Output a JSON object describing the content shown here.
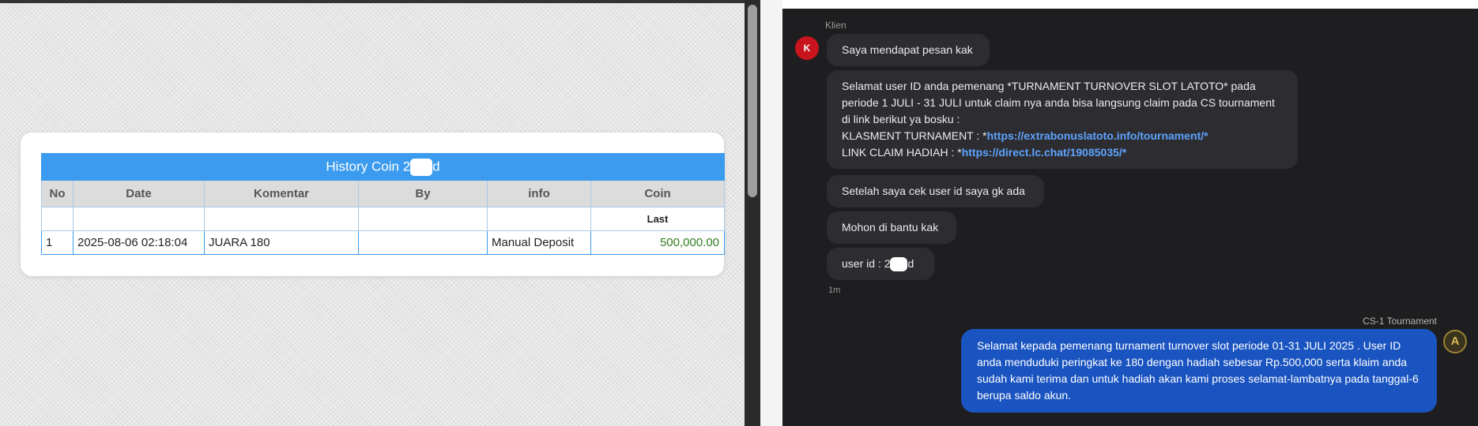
{
  "history": {
    "title_prefix": "History Coin 2",
    "title_suffix": "d",
    "columns": [
      "No",
      "Date",
      "Komentar",
      "By",
      "info",
      "Coin"
    ],
    "subheader": "Last",
    "rows": [
      {
        "no": "1",
        "date": "2025-08-06 02:18:04",
        "komentar": "JUARA 180",
        "by": "",
        "info": "Manual Deposit",
        "coin": "500,000.00"
      }
    ]
  },
  "chat": {
    "sender_label": "Klien",
    "client_avatar_letter": "K",
    "messages": {
      "m1": "Saya mendapat pesan kak",
      "m2_line1": "Selamat user ID anda pemenang *TURNAMENT TURNOVER SLOT LATOTO* pada",
      "m2_line2": "periode 1 JULI - 31 JULI untuk claim nya anda bisa langsung claim pada CS tournament",
      "m2_line3": "di link berikut ya bosku :",
      "m2_line4_prefix": "KLASMENT TURNAMENT : *",
      "m2_line4_link": "https://extrabonuslatoto.info/tournament/*",
      "m2_line5_prefix": "LINK CLAIM HADIAH : *",
      "m2_line5_link": "https://direct.lc.chat/19085035/*",
      "m3": "Setelah saya cek user id saya gk ada",
      "m4": "Mohon di bantu kak",
      "m5_prefix": "user id : 2",
      "m5_suffix": "d"
    },
    "time_label": "1m",
    "agent_label": "CS-1 Tournament",
    "agent_avatar_letter": "A",
    "agent_message": "Selamat kepada pemenang turnament turnover slot periode 01-31 JULI 2025 . User ID anda menduduki peringkat ke 180 dengan hadiah sebesar Rp.500,000 serta klaim anda sudah kami terima dan untuk hadiah akan kami proses selamat-lambatnya pada tanggal-6 berupa saldo akun."
  },
  "colors": {
    "table_header_blue": "#3a9bef",
    "coin_green": "#2f7d1f",
    "chat_bg": "#1e1e20",
    "client_bubble": "#2d2d31",
    "agent_bubble": "#1a54c0",
    "link_blue": "#5da3ff",
    "avatar_red": "#c8141c"
  }
}
